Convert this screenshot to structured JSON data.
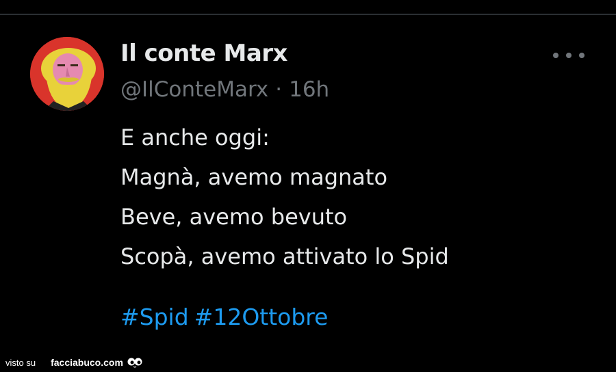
{
  "tweet": {
    "author": {
      "display_name": "Il conte Marx",
      "handle": "@IlConteMarx",
      "separator": "·",
      "time_ago": "16h",
      "avatar_icon": "karl-marx-pop-art-avatar"
    },
    "more_icon": "more-horizontal-icon",
    "text_lines": [
      "E anche oggi:",
      "Magnà, avemo magnato",
      "Beve, avemo bevuto",
      "Scopà, avemo attivato lo Spid"
    ],
    "hashtags": [
      "#Spid",
      "#12Ottobre"
    ]
  },
  "watermark": {
    "prefix": "visto su",
    "site": "facciabuco.com",
    "icon": "eyes-logo-icon"
  },
  "colors": {
    "background": "#000000",
    "text_primary": "#e7e9ea",
    "text_secondary": "#71767b",
    "link": "#1d9bf0",
    "avatar_bg": "#d9342b"
  }
}
